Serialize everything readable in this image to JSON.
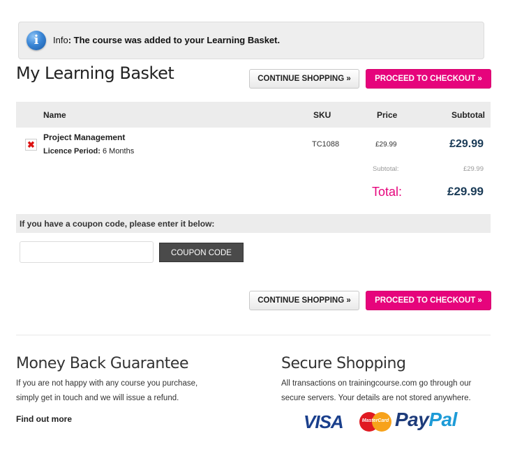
{
  "info": {
    "prefix": "Info",
    "message": ": The course was added to your Learning Basket."
  },
  "page_title": "My Learning Basket",
  "buttons": {
    "continue_shopping": "CONTINUE SHOPPING »",
    "proceed_checkout": "PROCEED TO CHECKOUT  »"
  },
  "table": {
    "headers": {
      "name": "Name",
      "sku": "SKU",
      "price": "Price",
      "subtotal": "Subtotal"
    },
    "items": [
      {
        "name": "Project Management",
        "licence_label": "Licence Period:",
        "licence_value": " 6 Months",
        "sku": "TC1088",
        "price": "£29.99",
        "subtotal": "£29.99"
      }
    ],
    "subtotal_label": "Subtotal:",
    "subtotal_value": "£29.99",
    "total_label": "Total:",
    "total_value": "£29.99"
  },
  "coupon": {
    "prompt": "If you have a coupon code, please enter it below:",
    "input_value": "",
    "button_label": "COUPON CODE"
  },
  "footer": {
    "guarantee": {
      "title": "Money Back Guarantee",
      "text": "If you are not happy with any course you purchase, simply get in touch and we will issue a refund.",
      "link": "Find out more"
    },
    "secure": {
      "title": "Secure Shopping",
      "text": "All transactions on trainingcourse.com go through our secure servers. Your details are not stored anywhere."
    },
    "payment_logos": {
      "visa": "VISA",
      "mastercard": "MasterCard",
      "paypal_1": "Pay",
      "paypal_2": "Pal"
    }
  },
  "colors": {
    "accent_pink": "#e6047c",
    "total_navy": "#1a3b57",
    "info_blue": "#3a86d6"
  }
}
